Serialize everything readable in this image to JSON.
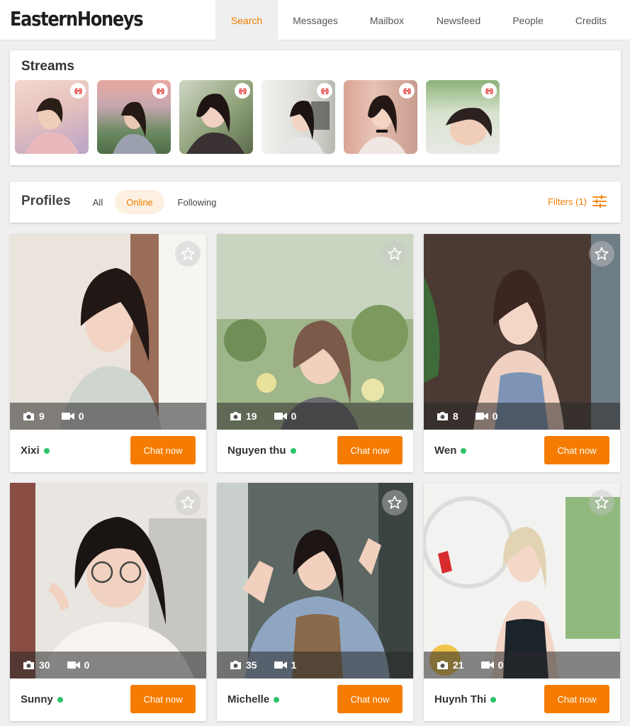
{
  "brand": {
    "logo": "EasternHoneys",
    "accent": "#f57c00"
  },
  "nav": [
    {
      "label": "Search",
      "active": true
    },
    {
      "label": "Messages"
    },
    {
      "label": "Mailbox"
    },
    {
      "label": "Newsfeed"
    },
    {
      "label": "People"
    },
    {
      "label": "Credits"
    }
  ],
  "streams": {
    "title": "Streams",
    "live_icon": "live-broadcast-icon",
    "count": 6
  },
  "profiles": {
    "title": "Profiles",
    "tabs": [
      {
        "label": "All"
      },
      {
        "label": "Online",
        "active": true
      },
      {
        "label": "Following"
      }
    ],
    "filters_label": "Filters (1)",
    "filters_icon": "sliders-icon",
    "cards": [
      {
        "name": "Xixi",
        "photos": "9",
        "videos": "0",
        "online": true,
        "chat_label": "Chat now"
      },
      {
        "name": "Nguyen thu",
        "photos": "19",
        "videos": "0",
        "online": true,
        "chat_label": "Chat now"
      },
      {
        "name": "Wen",
        "photos": "8",
        "videos": "0",
        "online": true,
        "chat_label": "Chat now"
      },
      {
        "name": "Sunny",
        "photos": "30",
        "videos": "0",
        "online": true,
        "chat_label": "Chat now"
      },
      {
        "name": "Michelle",
        "photos": "35",
        "videos": "1",
        "online": true,
        "chat_label": "Chat now"
      },
      {
        "name": "Huynh Thi",
        "photos": "21",
        "videos": "0",
        "online": true,
        "chat_label": "Chat now"
      }
    ]
  }
}
